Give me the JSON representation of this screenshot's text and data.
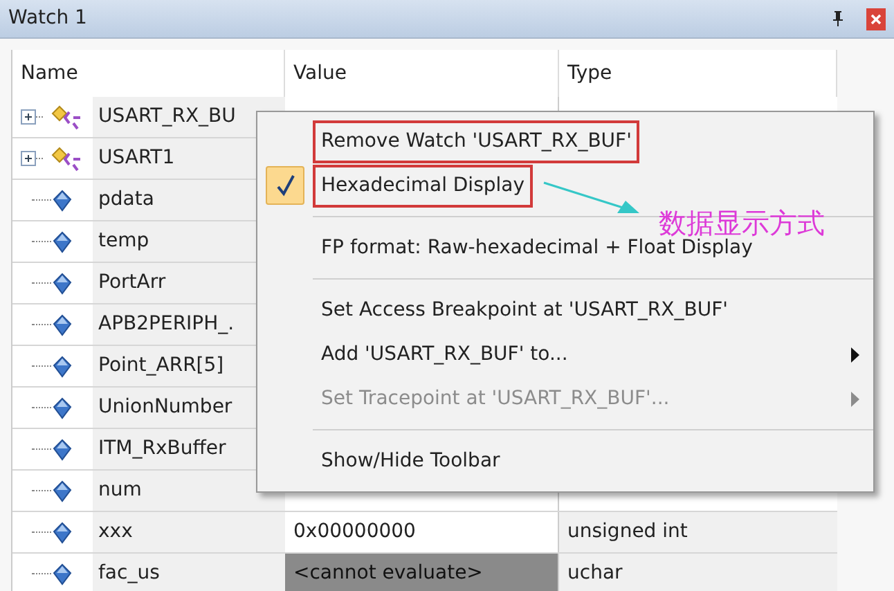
{
  "window": {
    "title": "Watch 1"
  },
  "table": {
    "columns": [
      "Name",
      "Value",
      "Type"
    ],
    "rows": [
      {
        "name": "USART_RX_BU",
        "kind": "struct",
        "expanded": false
      },
      {
        "name": "USART1",
        "kind": "struct",
        "expanded": false
      },
      {
        "name": "pdata",
        "kind": "variable"
      },
      {
        "name": "temp",
        "kind": "variable"
      },
      {
        "name": "PortArr",
        "kind": "variable"
      },
      {
        "name": "APB2PERIPH_.",
        "kind": "variable"
      },
      {
        "name": "Point_ARR[5]",
        "kind": "variable"
      },
      {
        "name": "UnionNumber",
        "kind": "variable"
      },
      {
        "name": "ITM_RxBuffer",
        "kind": "variable"
      },
      {
        "name": "num",
        "kind": "variable"
      },
      {
        "name": "xxx",
        "kind": "variable",
        "value": "0x00000000",
        "type": "unsigned int",
        "evaluable": true
      },
      {
        "name": "fac_us",
        "kind": "variable",
        "value": "<cannot evaluate>",
        "type": "uchar",
        "evaluable": false
      }
    ]
  },
  "context_menu": {
    "items": [
      {
        "kind": "item",
        "label": "Remove Watch 'USART_RX_BUF'",
        "checked": false,
        "disabled": false,
        "submenu": false,
        "highlighted": true
      },
      {
        "kind": "item",
        "label": "Hexadecimal Display",
        "checked": true,
        "disabled": false,
        "submenu": false,
        "highlighted": true
      },
      {
        "kind": "separator"
      },
      {
        "kind": "item",
        "label": "FP format: Raw-hexadecimal + Float Display",
        "checked": false,
        "disabled": false,
        "submenu": false,
        "highlighted": false
      },
      {
        "kind": "separator"
      },
      {
        "kind": "item",
        "label": "Set Access Breakpoint at 'USART_RX_BUF'",
        "checked": false,
        "disabled": false,
        "submenu": false,
        "highlighted": false
      },
      {
        "kind": "item",
        "label": "Add 'USART_RX_BUF' to...",
        "checked": false,
        "disabled": false,
        "submenu": true,
        "highlighted": false
      },
      {
        "kind": "item",
        "label": "Set Tracepoint at 'USART_RX_BUF'...",
        "checked": false,
        "disabled": true,
        "submenu": true,
        "highlighted": false
      },
      {
        "kind": "separator"
      },
      {
        "kind": "item",
        "label": "Show/Hide Toolbar",
        "checked": false,
        "disabled": false,
        "submenu": false,
        "highlighted": false
      }
    ]
  },
  "annotation": {
    "text": "数据显示方式"
  }
}
